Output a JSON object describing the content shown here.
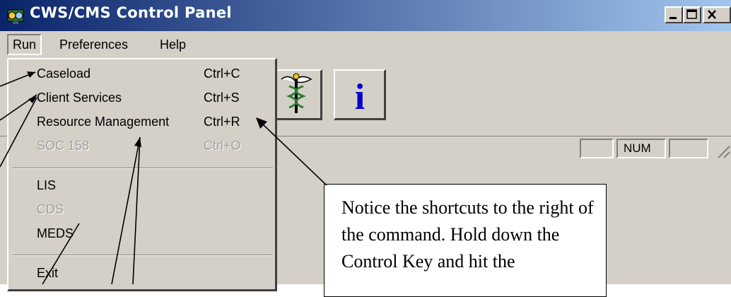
{
  "window": {
    "title": "CWS/CMS Control Panel"
  },
  "menubar": {
    "items": [
      "Run",
      "Preferences",
      "Help"
    ]
  },
  "run_menu": {
    "items": [
      {
        "label": "Caseload",
        "shortcut": "Ctrl+C",
        "enabled": true
      },
      {
        "label": "Client Services",
        "shortcut": "Ctrl+S",
        "enabled": true
      },
      {
        "label": "Resource Management",
        "shortcut": "Ctrl+R",
        "enabled": true
      },
      {
        "label": "SOC 158",
        "shortcut": "Ctrl+O",
        "enabled": false
      },
      {
        "label": "LIS",
        "shortcut": "",
        "enabled": true
      },
      {
        "label": "CDS",
        "shortcut": "",
        "enabled": false
      },
      {
        "label": "MEDS",
        "shortcut": "",
        "enabled": true
      },
      {
        "label": "Exit",
        "shortcut": "",
        "enabled": true
      }
    ]
  },
  "toolbar": {
    "buttons": [
      "house-icon",
      "keyboard-icon",
      "caduceus-icon",
      "info-icon"
    ],
    "info_glyph": "i"
  },
  "statusbar": {
    "num_indicator": "NUM"
  },
  "callout": {
    "text": "Notice the shortcuts to the right of the command.  Hold down the Control Key and hit the"
  },
  "colors": {
    "titlebar_start": "#0a246a",
    "titlebar_end": "#a6caf0",
    "face": "#d4d0c8",
    "info_blue": "#0000cc"
  }
}
